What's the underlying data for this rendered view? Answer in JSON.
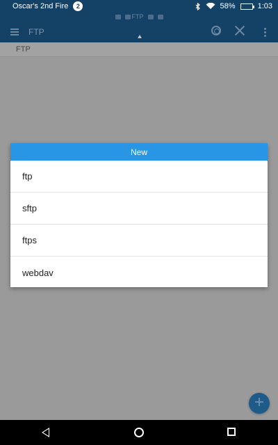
{
  "status_bar": {
    "device_name": "Oscar's 2nd Fire",
    "notification_count": "2",
    "battery": "58%",
    "battery_level": 0.58,
    "time": "1:03",
    "icons": [
      "bluetooth-icon",
      "wifi-icon",
      "battery-charging-icon"
    ]
  },
  "app_bar": {
    "title": "FTP",
    "tab_label": "FTP",
    "icons": [
      "hamburger-icon",
      "target-icon",
      "close-icon",
      "more-icon"
    ]
  },
  "breadcrumb": "FTP",
  "dialog": {
    "title": "New",
    "items": [
      "ftp",
      "sftp",
      "ftps",
      "webdav"
    ]
  },
  "fab": {
    "label": "+"
  },
  "colors": {
    "status_bar": "#134266",
    "dialog_header": "#2996e5",
    "fab": "#1e5b88",
    "scrim": "#9a9a9a"
  }
}
